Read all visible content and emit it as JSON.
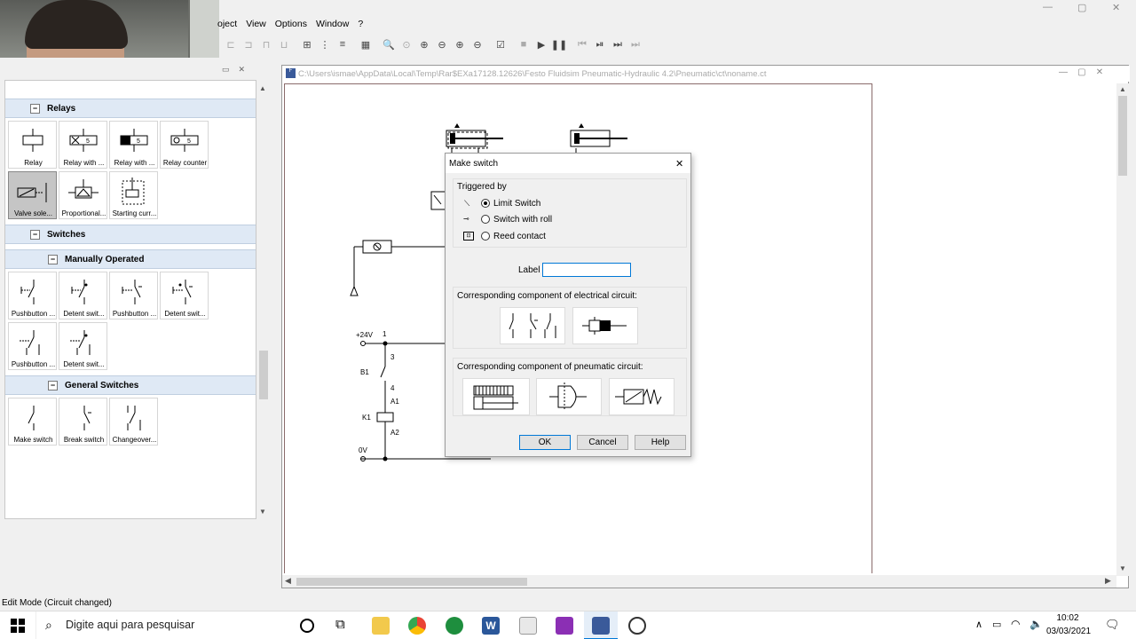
{
  "menu": {
    "items": [
      "oject",
      "View",
      "Options",
      "Window",
      "?"
    ]
  },
  "doc": {
    "title": "C:\\Users\\ismae\\AppData\\Local\\Temp\\Rar$EXa17128.12626\\Festo Fluidsim Pneumatic-Hydraulic 4.2\\Pneumatic\\ct\\noname.ct"
  },
  "library": {
    "sections": {
      "relays": "Relays",
      "switches": "Switches",
      "manual": "Manually Operated",
      "general": "General Switches"
    },
    "relay_tiles": [
      "Relay",
      "Relay with ...",
      "Relay with ...",
      "Relay counter",
      "Valve sole...",
      "Proportional...",
      "Starting curr..."
    ],
    "manual_tiles": [
      "Pushbutton ...",
      "Detent swit...",
      "Pushbutton ...",
      "Detent swit...",
      "Pushbutton ...",
      "Detent swit..."
    ],
    "general_tiles": [
      "Make switch",
      "Break switch",
      "Changeover..."
    ]
  },
  "circuit": {
    "labels": {
      "v24": "+24V",
      "n1": "1",
      "n3": "3",
      "b1": "B1",
      "n4": "4",
      "a1": "A1",
      "k1": "K1",
      "a2": "A2",
      "v0": "0V"
    }
  },
  "dialog": {
    "title": "Make switch",
    "close": "✕",
    "triggered_by": "Triggered by",
    "options": [
      {
        "label": "Limit Switch",
        "selected": true
      },
      {
        "label": "Switch with roll",
        "selected": false
      },
      {
        "label": "Reed contact",
        "selected": false
      }
    ],
    "label_caption": "Label",
    "label_value": "",
    "electrical_caption": "Corresponding component of electrical circuit:",
    "pneumatic_caption": "Corresponding component of pneumatic circuit:",
    "ok": "OK",
    "cancel": "Cancel",
    "help": "Help"
  },
  "status": {
    "text": "Edit Mode (Circuit changed)"
  },
  "taskbar": {
    "search_placeholder": "Digite aqui para pesquisar",
    "time": "10:02",
    "date": "03/03/2021"
  },
  "colors": {
    "accent": "#0078d7",
    "section_header": "#dfe9f5",
    "page_border": "#8a6b6b"
  }
}
